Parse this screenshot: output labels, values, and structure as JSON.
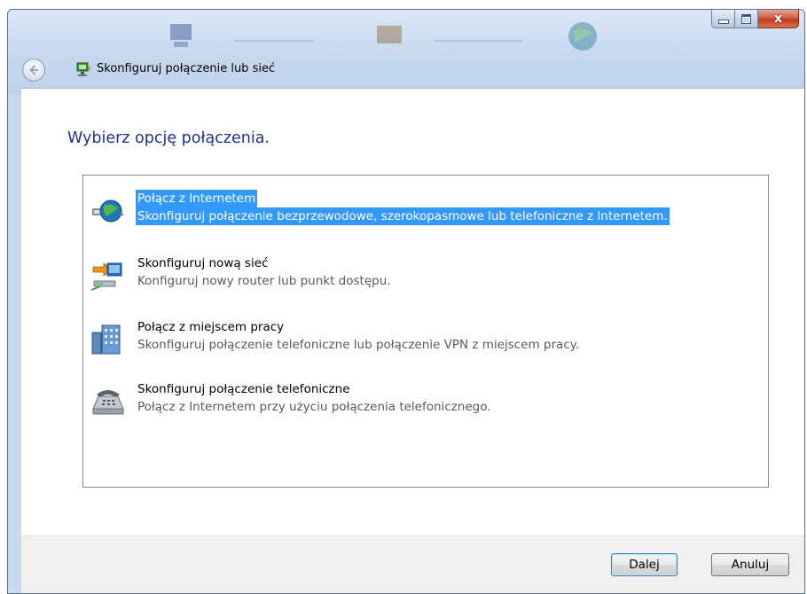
{
  "window": {
    "title": "Skonfiguruj połączenie lub sieć",
    "buttons": {
      "minimize": "minimize",
      "maximize": "maximize",
      "close": "x"
    }
  },
  "page": {
    "heading": "Wybierz opcję połączenia."
  },
  "options": [
    {
      "title": "Połącz z Internetem",
      "description": "Skonfiguruj połączenie bezprzewodowe, szerokopasmowe lub telefoniczne z Internetem.",
      "icon": "globe-network-icon",
      "selected": true
    },
    {
      "title": "Skonfiguruj nową sieć",
      "description": "Konfiguruj nowy router lub punkt dostępu.",
      "icon": "router-setup-icon",
      "selected": false
    },
    {
      "title": "Połącz z miejscem pracy",
      "description": "Skonfiguruj połączenie telefoniczne lub połączenie VPN z miejscem pracy.",
      "icon": "workplace-building-icon",
      "selected": false
    },
    {
      "title": "Skonfiguruj połączenie telefoniczne",
      "description": "Połącz z Internetem przy użyciu połączenia telefonicznego.",
      "icon": "telephone-icon",
      "selected": false
    }
  ],
  "footer": {
    "next_label": "Dalej",
    "cancel_label": "Anuluj"
  },
  "colors": {
    "heading": "#1e3287",
    "selection": "#3399ff",
    "close_button": "#c2391d"
  }
}
